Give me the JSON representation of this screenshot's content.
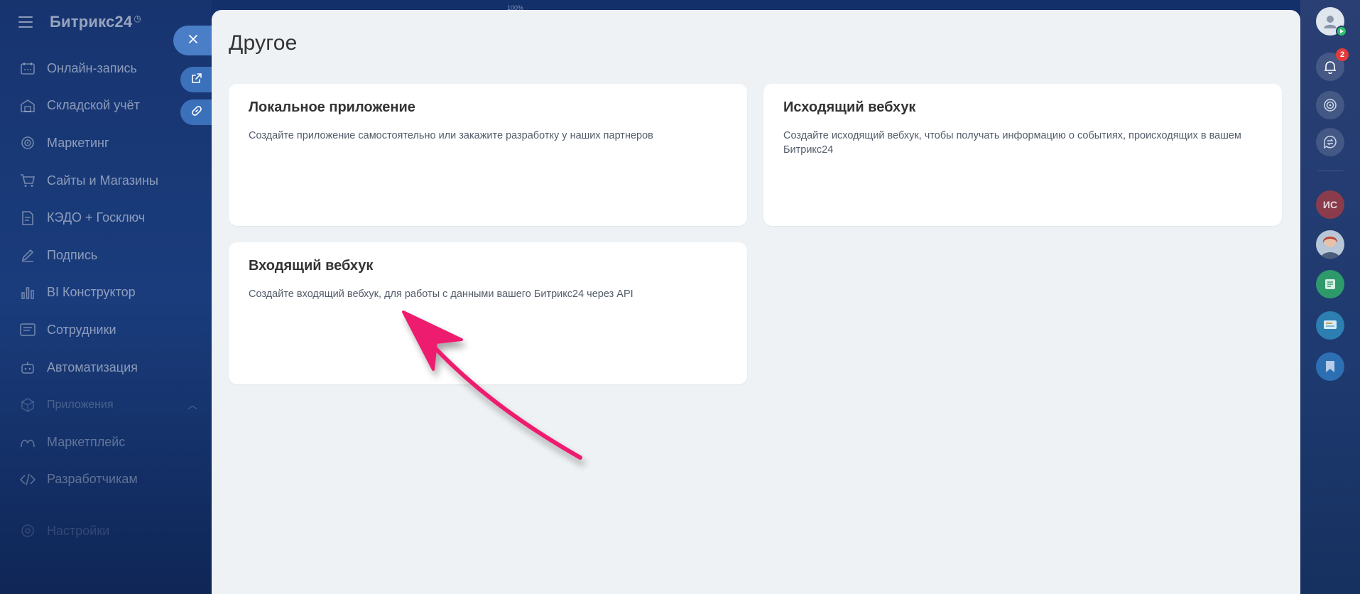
{
  "brand": {
    "name": "Битрикс24",
    "clock_icon": "clock-icon"
  },
  "zoom": "100%",
  "sidebar": {
    "items": [
      {
        "label": "Онлайн-запись",
        "icon": "calendar-icon"
      },
      {
        "label": "Складской учёт",
        "icon": "warehouse-icon"
      },
      {
        "label": "Маркетинг",
        "icon": "target-icon"
      },
      {
        "label": "Сайты и Магазины",
        "icon": "cart-icon"
      },
      {
        "label": "КЭДО + Госключ",
        "icon": "document-icon"
      },
      {
        "label": "Подпись",
        "icon": "pen-icon"
      },
      {
        "label": "BI Конструктор",
        "icon": "bar-chart-icon"
      },
      {
        "label": "Сотрудники",
        "icon": "people-icon"
      },
      {
        "label": "Автоматизация",
        "icon": "robot-icon"
      },
      {
        "label": "Приложения",
        "icon": "cube-icon"
      },
      {
        "label": "Маркетплейс",
        "icon": "market-icon"
      },
      {
        "label": "Разработчикам",
        "icon": "code-icon"
      }
    ],
    "settings_label": "Настройки"
  },
  "panel": {
    "title": "Другое",
    "cards": [
      {
        "title": "Локальное приложение",
        "description": "Создайте приложение самостоятельно или закажите разработку у наших партнеров"
      },
      {
        "title": "Исходящий вебхук",
        "description": "Создайте исходящий вебхук, чтобы получать информацию о событиях, происходящих в вашем Битрикс24"
      },
      {
        "title": "Входящий вебхук",
        "description": "Создайте входящий вебхук, для работы с данными вашего Битрикс24 через API"
      }
    ]
  },
  "rail": {
    "notifications_count": "2",
    "initials": "ИС"
  },
  "colors": {
    "arrow": "#ee1b6e",
    "panel_bg": "#eef2f4",
    "accent_blue": "#3f78c4"
  }
}
